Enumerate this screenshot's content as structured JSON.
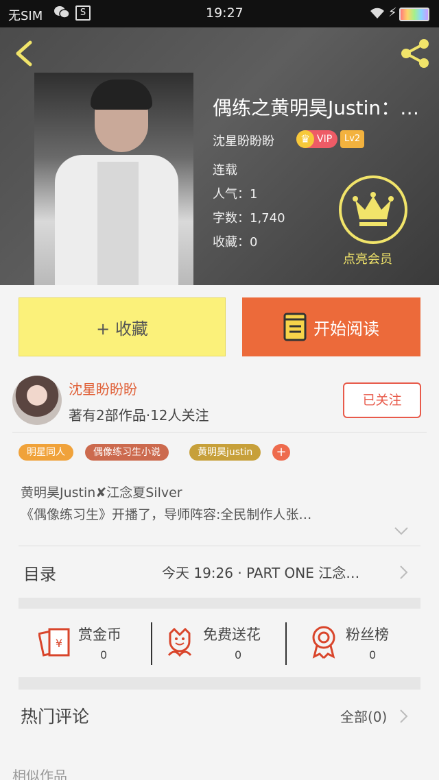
{
  "status_bar": {
    "carrier": "无SIM",
    "time": "19:27"
  },
  "book": {
    "title": "偶练之黄明昊Justin：…",
    "author": "沈星盼盼盼",
    "vip_label": "VIP",
    "level": "Lv2",
    "status": "连载",
    "popularity": "人气：1",
    "word_count": "字数：1,740",
    "favorites": "收藏：0",
    "member_label": "点亮会员"
  },
  "actions": {
    "favorite_label": "+ 收藏",
    "read_label": "开始阅读"
  },
  "author_row": {
    "name": "沈星盼盼盼",
    "stats": "著有2部作品·12人关注",
    "follow_label": "已关注"
  },
  "tags": [
    {
      "label": "明星同人",
      "color": "#f0a23a"
    },
    {
      "label": "偶像练习生小说",
      "color": "#cc6a4e"
    },
    {
      "label": "黄明昊justin",
      "color": "#c7a03a"
    }
  ],
  "tag_add": "+",
  "description": {
    "line1": "黄明昊Justin✘江念夏Silver",
    "line2": "《偶像练习生》开播了，导师阵容:全民制作人张…"
  },
  "toc": {
    "label": "目录",
    "latest": "今天 19:26 · PART ONE 江念…"
  },
  "stats": [
    {
      "label": "赏金币",
      "value": "0",
      "icon": "red-envelope-icon"
    },
    {
      "label": "免费送花",
      "value": "0",
      "icon": "flower-icon"
    },
    {
      "label": "粉丝榜",
      "value": "0",
      "icon": "ribbon-award-icon"
    }
  ],
  "comments": {
    "label": "热门评论",
    "all_label": "全部(0)"
  },
  "similar": {
    "label": "相似作品"
  },
  "colors": {
    "accent_orange": "#ec6a3a",
    "fav_yellow": "#fbf17a",
    "member_yellow": "#f1e46a",
    "icon_red": "#d9452b"
  }
}
